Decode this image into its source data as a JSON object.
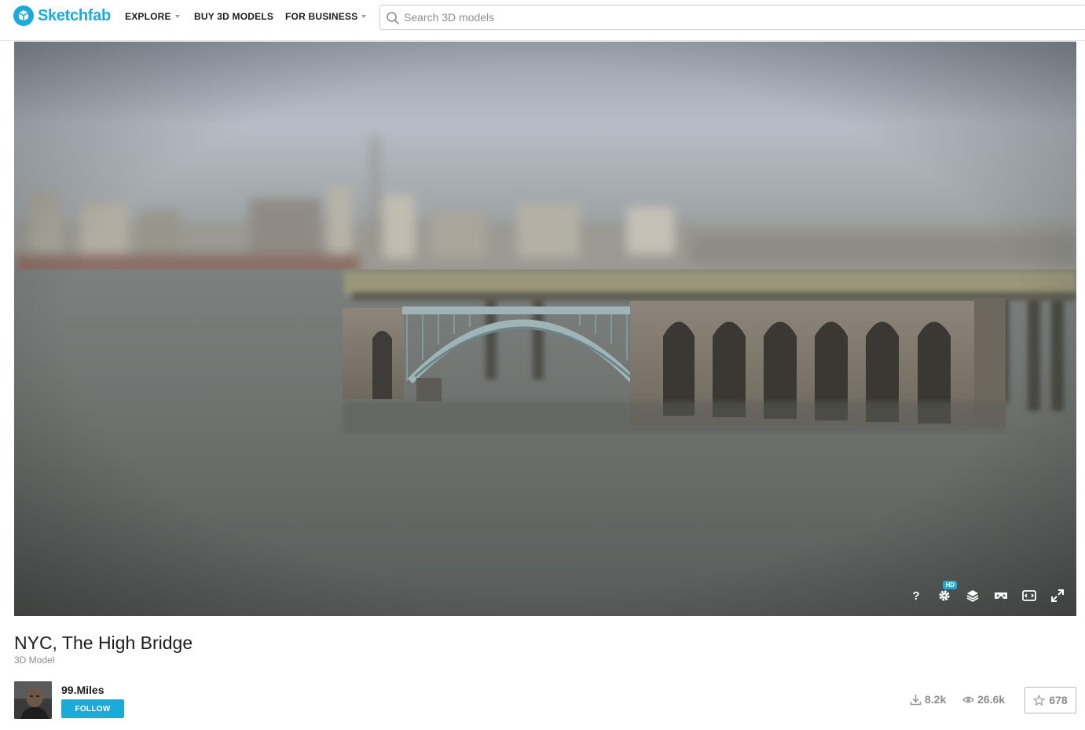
{
  "header": {
    "brand": "Sketchfab",
    "nav": {
      "explore": "EXPLORE",
      "buy": "BUY 3D MODELS",
      "business": "FOR BUSINESS"
    },
    "search": {
      "placeholder": "Search 3D models",
      "value": ""
    }
  },
  "viewer": {
    "controls": {
      "help_label": "?",
      "hd_badge": "HD"
    }
  },
  "model": {
    "title": "NYC, The High Bridge",
    "type": "3D Model"
  },
  "author": {
    "name": "99.Miles",
    "follow_label": "FOLLOW"
  },
  "stats": {
    "downloads": "8.2k",
    "views": "26.6k",
    "likes": "678"
  },
  "colors": {
    "brand": "#1caad9",
    "text": "#1c1c1c",
    "muted": "#8c8c8c"
  }
}
